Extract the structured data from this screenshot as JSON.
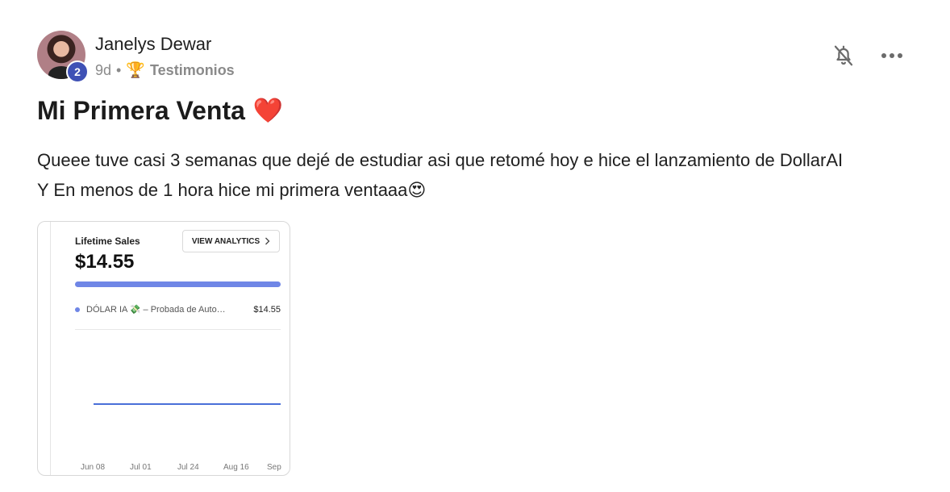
{
  "post": {
    "author": {
      "name": "Janelys Dewar",
      "level": "2"
    },
    "meta": {
      "age": "9d",
      "separator": "•",
      "category_icon": "trophy-icon",
      "category": "Testimonios"
    },
    "actions": {
      "notifications_icon": "bell-off-icon",
      "more_icon": "more-horizontal-icon"
    },
    "title": "Mi Primera Venta",
    "title_emoji": "❤️",
    "body_lines": [
      "Queee tuve casi 3 semanas que dejé de estudiar asi que retomé hoy e hice el lanzamiento de DollarAI",
      "Y En menos de 1 hora hice mi primera ventaaa😍"
    ],
    "attachment": {
      "label": "Lifetime Sales",
      "amount": "$14.55",
      "button_label": "VIEW ANALYTICS",
      "product_name": "DÓLAR IA 💸 – Probada de Auto…",
      "product_value": "$14.55",
      "axis_labels": [
        "Jun 08",
        "Jul 01",
        "Jul 24",
        "Aug 16",
        "Sep"
      ],
      "accent_color": "#6f86e6"
    }
  }
}
